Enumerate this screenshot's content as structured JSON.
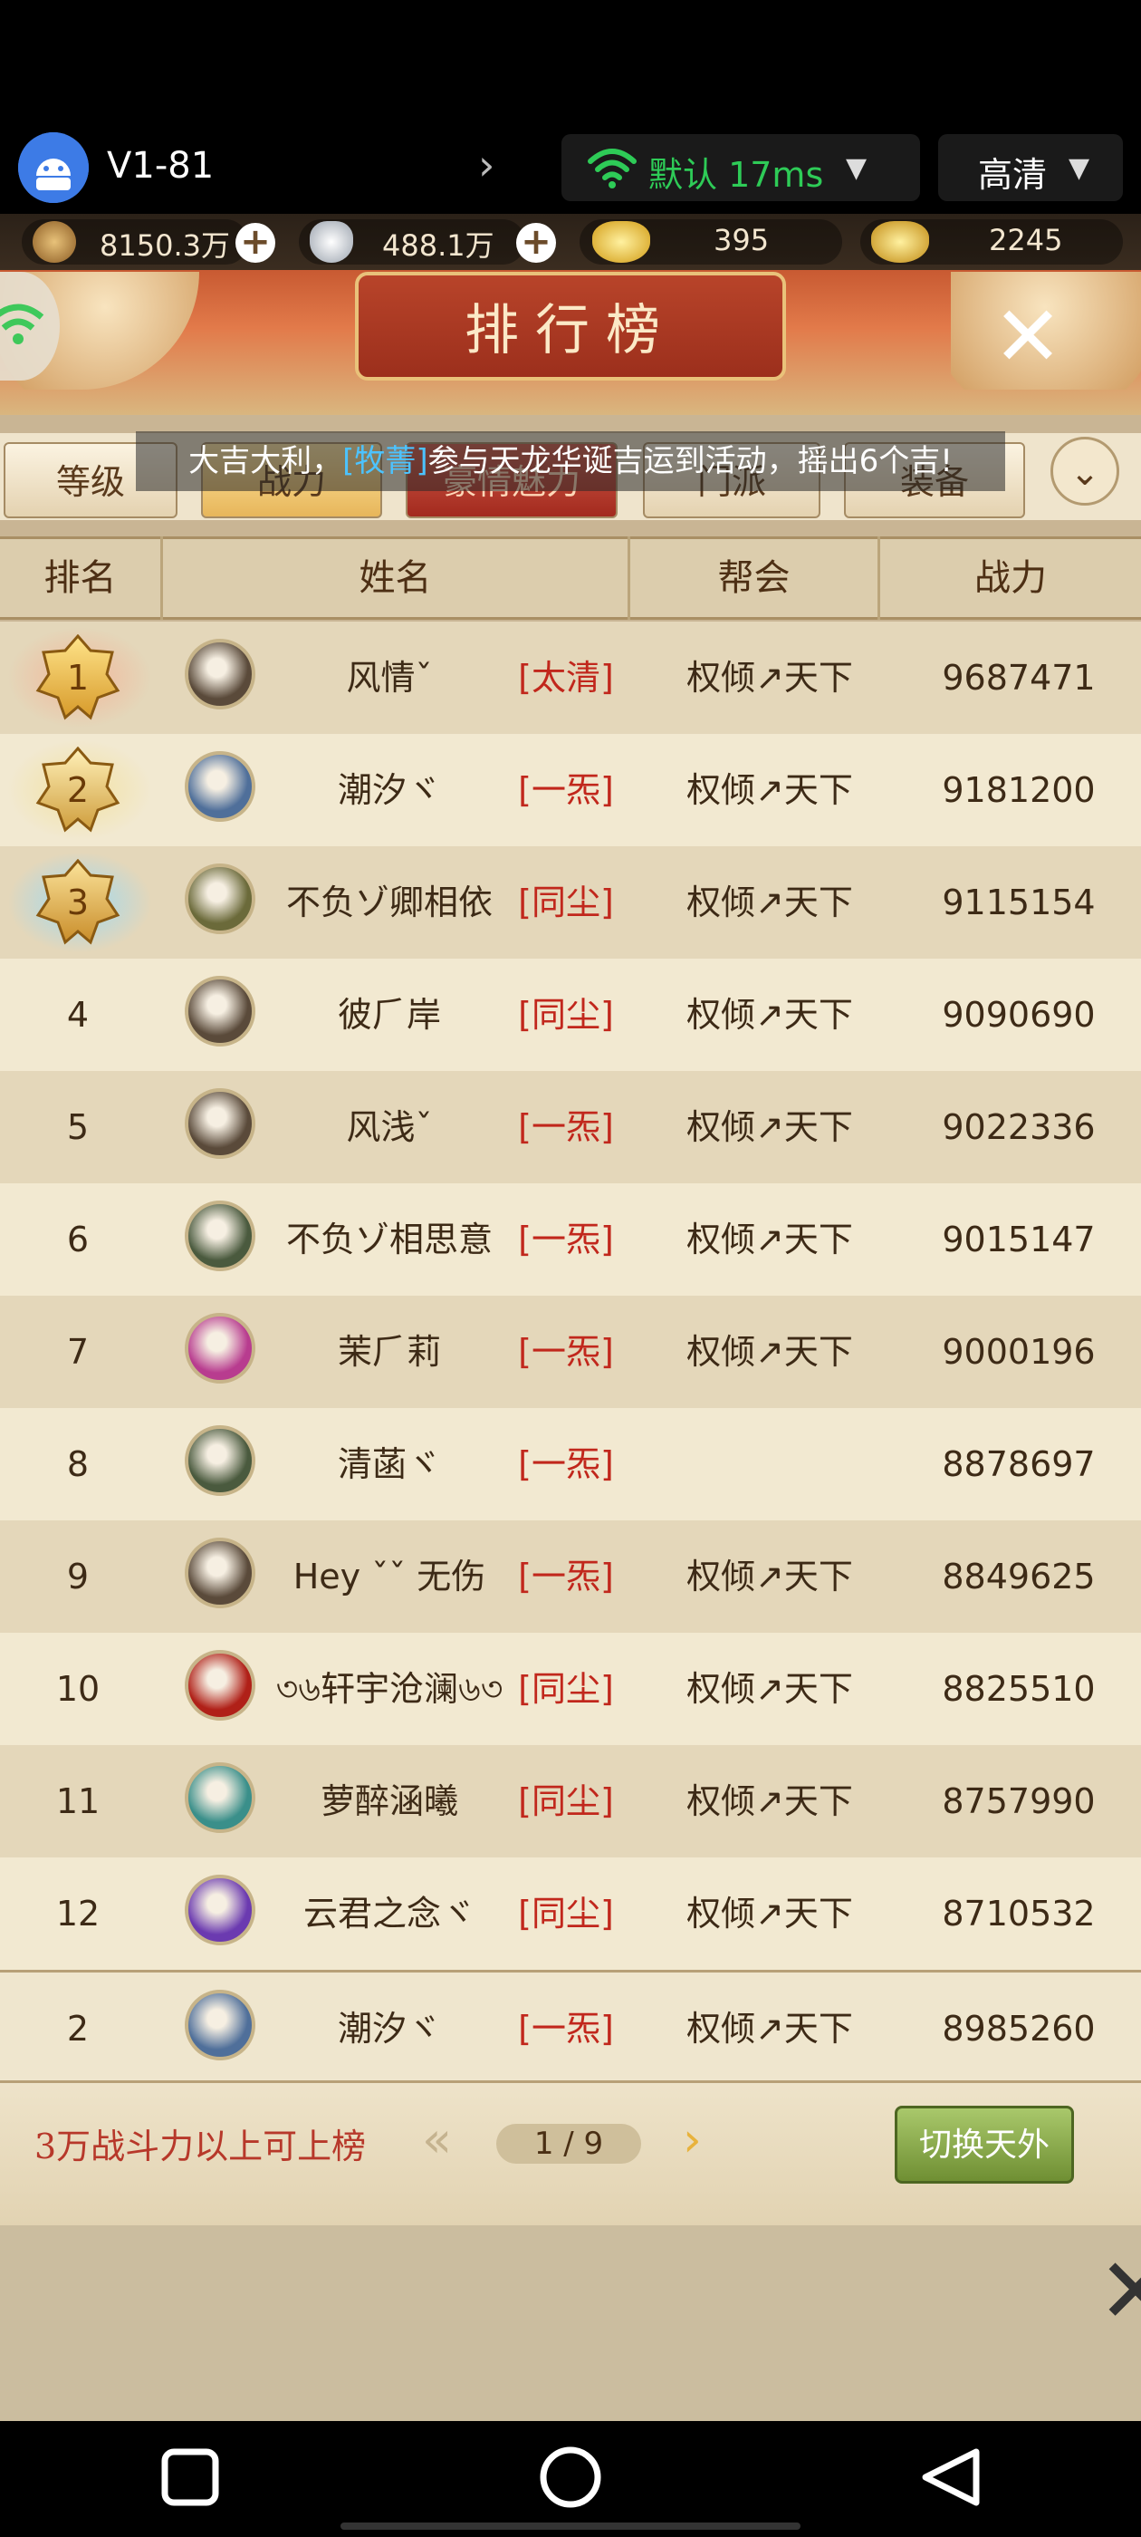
{
  "stream_bar": {
    "device_name": "V1-81",
    "network": "默认 17ms",
    "quality": "高清",
    "colors": {
      "network_green": "#2ecb57"
    }
  },
  "resources": [
    {
      "icon": "copper-coin-icon",
      "value": "8150.3万",
      "has_plus": true
    },
    {
      "icon": "silver-ingot-icon",
      "value": "488.1万",
      "has_plus": true
    },
    {
      "icon": "gold-ingot-icon",
      "value": "395",
      "has_plus": false
    },
    {
      "icon": "locked-gold-icon",
      "value": "2245",
      "has_plus": false
    }
  ],
  "page": {
    "title": "排行榜"
  },
  "tabs": [
    "等级",
    "战力",
    "豪情魅力",
    "门派",
    "装备"
  ],
  "active_tab": "战力",
  "announcement": {
    "prefix": "大吉大利，",
    "player": "[牧菁]",
    "suffix": "参与天龙华诞吉运到活动，摇出6个吉!"
  },
  "table": {
    "headers": [
      "排名",
      "姓名",
      "帮会",
      "战力"
    ],
    "rows": [
      {
        "rank": "1",
        "medal": "gold",
        "name": "风情ˇ",
        "school": "[太清]",
        "guild": "权倾↗天下",
        "power": "9687471",
        "avatar_color": "#5a4a3a"
      },
      {
        "rank": "2",
        "medal": "silver",
        "name": "潮汐ヾ",
        "school": "[一炁]",
        "guild": "权倾↗天下",
        "power": "9181200",
        "avatar_color": "#4f6f9a"
      },
      {
        "rank": "3",
        "medal": "bronze",
        "name": "不负ゾ卿相依",
        "school": "[同尘]",
        "guild": "权倾↗天下",
        "power": "9115154",
        "avatar_color": "#6b6a3a"
      },
      {
        "rank": "4",
        "medal": "",
        "name": "彼⺁岸",
        "school": "[同尘]",
        "guild": "权倾↗天下",
        "power": "9090690",
        "avatar_color": "#5a4a3a"
      },
      {
        "rank": "5",
        "medal": "",
        "name": "风浅ˇ",
        "school": "[一炁]",
        "guild": "权倾↗天下",
        "power": "9022336",
        "avatar_color": "#5a4a3a"
      },
      {
        "rank": "6",
        "medal": "",
        "name": "不负ゾ相思意",
        "school": "[一炁]",
        "guild": "权倾↗天下",
        "power": "9015147",
        "avatar_color": "#4a5a3e"
      },
      {
        "rank": "7",
        "medal": "",
        "name": "茉⺁莉",
        "school": "[一炁]",
        "guild": "权倾↗天下",
        "power": "9000196",
        "avatar_color": "#b83c8f"
      },
      {
        "rank": "8",
        "medal": "",
        "name": "清菡ヾ",
        "school": "[一炁]",
        "guild": "",
        "power": "8878697",
        "avatar_color": "#4a5a3e"
      },
      {
        "rank": "9",
        "medal": "",
        "name": "Hey ˇˇ 无伤",
        "school": "[一炁]",
        "guild": "权倾↗天下",
        "power": "8849625",
        "avatar_color": "#5a4a3a"
      },
      {
        "rank": "10",
        "medal": "",
        "name": "৩৬轩宇沧澜৬৩",
        "school": "[同尘]",
        "guild": "权倾↗天下",
        "power": "8825510",
        "avatar_color": "#b02018"
      },
      {
        "rank": "11",
        "medal": "",
        "name": "萝醉涵曦",
        "school": "[同尘]",
        "guild": "权倾↗天下",
        "power": "8757990",
        "avatar_color": "#3a8f8a"
      },
      {
        "rank": "12",
        "medal": "",
        "name": "云君之念ヾ",
        "school": "[同尘]",
        "guild": "权倾↗天下",
        "power": "8710532",
        "avatar_color": "#6b3ab0"
      }
    ],
    "my_row": {
      "rank": "2",
      "name": "潮汐ヾ",
      "school": "[一炁]",
      "guild": "权倾↗天下",
      "power": "8985260",
      "avatar_color": "#4f6f9a"
    }
  },
  "footer": {
    "note": "3万战斗力以上可上榜",
    "page": "1 / 9",
    "switch_button": "切换天外"
  }
}
